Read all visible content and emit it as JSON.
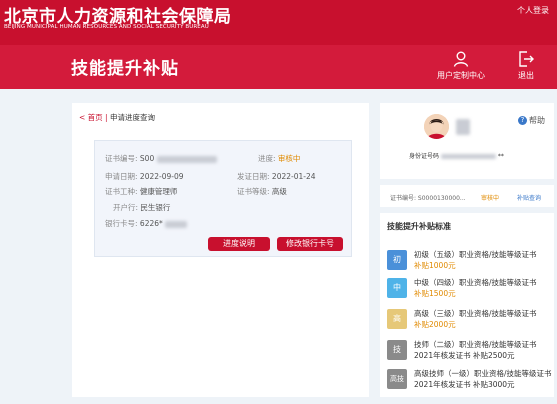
{
  "header": {
    "org_cn": "北京市人力资源和社会保障局",
    "org_en": "BEIJING MUNICIPAL HUMAN RESOURCES AND SOCIAL SECURITY BUREAU",
    "login": "个人登录"
  },
  "band": {
    "title": "技能提升补贴",
    "user_center": "用户定制中心",
    "logout": "退出"
  },
  "crumb": {
    "home": "< 首页",
    "sep": " | ",
    "current": "申请进度查询"
  },
  "record": {
    "cert_no_label": "证书编号:",
    "cert_no_value": "S00",
    "progress_label": "进度:",
    "progress_value": "审核中",
    "apply_date_label": "申请日期:",
    "apply_date_value": "2022-09-09",
    "issue_date_label": "发证日期:",
    "issue_date_value": "2022-01-24",
    "job_label": "证书工种:",
    "job_value": "健康管理师",
    "level_label": "证书等级:",
    "level_value": "高级",
    "bank_label": "开户行:",
    "bank_value": "民生银行",
    "card_label": "银行卡号:",
    "card_value": "6226*",
    "btn_progress": "进度说明",
    "btn_modify": "修改银行卡号"
  },
  "profile": {
    "help": "帮助",
    "id_label": "身份证号码",
    "id_suffix": "**"
  },
  "summary": {
    "cert": "证书编号: S0000130000...",
    "status": "审核中",
    "query": "补贴查询"
  },
  "standards": {
    "title": "技能提升补贴标准",
    "items": [
      {
        "badge": "初",
        "color": "#4a90d9",
        "line1": "初级（五级）职业资格/技能等级证书",
        "line2": "补贴1000元"
      },
      {
        "badge": "中",
        "color": "#4fb3e8",
        "line1": "中级（四级）职业资格/技能等级证书",
        "line2": "补贴1500元"
      },
      {
        "badge": "高",
        "color": "#e6c878",
        "line1": "高级（三级）职业资格/技能等级证书",
        "line2": "补贴2000元"
      },
      {
        "badge": "技",
        "color": "#8a8a8a",
        "line1": "技师（二级）职业资格/技能等级证书",
        "line2": "2021年核发证书 补贴2500元"
      },
      {
        "badge": "高技",
        "color": "#8a8a8a",
        "line1": "高级技师（一级）职业资格/技能等级证书",
        "line2": "2021年核发证书 补贴3000元"
      }
    ]
  }
}
